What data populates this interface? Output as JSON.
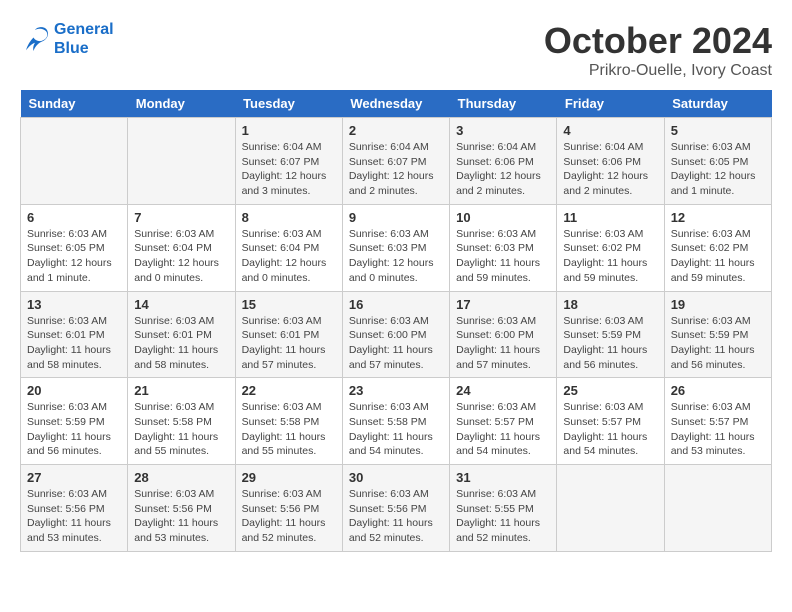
{
  "header": {
    "logo_line1": "General",
    "logo_line2": "Blue",
    "month": "October 2024",
    "location": "Prikro-Ouelle, Ivory Coast"
  },
  "weekdays": [
    "Sunday",
    "Monday",
    "Tuesday",
    "Wednesday",
    "Thursday",
    "Friday",
    "Saturday"
  ],
  "weeks": [
    [
      {
        "day": "",
        "info": ""
      },
      {
        "day": "",
        "info": ""
      },
      {
        "day": "1",
        "info": "Sunrise: 6:04 AM\nSunset: 6:07 PM\nDaylight: 12 hours and 3 minutes."
      },
      {
        "day": "2",
        "info": "Sunrise: 6:04 AM\nSunset: 6:07 PM\nDaylight: 12 hours and 2 minutes."
      },
      {
        "day": "3",
        "info": "Sunrise: 6:04 AM\nSunset: 6:06 PM\nDaylight: 12 hours and 2 minutes."
      },
      {
        "day": "4",
        "info": "Sunrise: 6:04 AM\nSunset: 6:06 PM\nDaylight: 12 hours and 2 minutes."
      },
      {
        "day": "5",
        "info": "Sunrise: 6:03 AM\nSunset: 6:05 PM\nDaylight: 12 hours and 1 minute."
      }
    ],
    [
      {
        "day": "6",
        "info": "Sunrise: 6:03 AM\nSunset: 6:05 PM\nDaylight: 12 hours and 1 minute."
      },
      {
        "day": "7",
        "info": "Sunrise: 6:03 AM\nSunset: 6:04 PM\nDaylight: 12 hours and 0 minutes."
      },
      {
        "day": "8",
        "info": "Sunrise: 6:03 AM\nSunset: 6:04 PM\nDaylight: 12 hours and 0 minutes."
      },
      {
        "day": "9",
        "info": "Sunrise: 6:03 AM\nSunset: 6:03 PM\nDaylight: 12 hours and 0 minutes."
      },
      {
        "day": "10",
        "info": "Sunrise: 6:03 AM\nSunset: 6:03 PM\nDaylight: 11 hours and 59 minutes."
      },
      {
        "day": "11",
        "info": "Sunrise: 6:03 AM\nSunset: 6:02 PM\nDaylight: 11 hours and 59 minutes."
      },
      {
        "day": "12",
        "info": "Sunrise: 6:03 AM\nSunset: 6:02 PM\nDaylight: 11 hours and 59 minutes."
      }
    ],
    [
      {
        "day": "13",
        "info": "Sunrise: 6:03 AM\nSunset: 6:01 PM\nDaylight: 11 hours and 58 minutes."
      },
      {
        "day": "14",
        "info": "Sunrise: 6:03 AM\nSunset: 6:01 PM\nDaylight: 11 hours and 58 minutes."
      },
      {
        "day": "15",
        "info": "Sunrise: 6:03 AM\nSunset: 6:01 PM\nDaylight: 11 hours and 57 minutes."
      },
      {
        "day": "16",
        "info": "Sunrise: 6:03 AM\nSunset: 6:00 PM\nDaylight: 11 hours and 57 minutes."
      },
      {
        "day": "17",
        "info": "Sunrise: 6:03 AM\nSunset: 6:00 PM\nDaylight: 11 hours and 57 minutes."
      },
      {
        "day": "18",
        "info": "Sunrise: 6:03 AM\nSunset: 5:59 PM\nDaylight: 11 hours and 56 minutes."
      },
      {
        "day": "19",
        "info": "Sunrise: 6:03 AM\nSunset: 5:59 PM\nDaylight: 11 hours and 56 minutes."
      }
    ],
    [
      {
        "day": "20",
        "info": "Sunrise: 6:03 AM\nSunset: 5:59 PM\nDaylight: 11 hours and 56 minutes."
      },
      {
        "day": "21",
        "info": "Sunrise: 6:03 AM\nSunset: 5:58 PM\nDaylight: 11 hours and 55 minutes."
      },
      {
        "day": "22",
        "info": "Sunrise: 6:03 AM\nSunset: 5:58 PM\nDaylight: 11 hours and 55 minutes."
      },
      {
        "day": "23",
        "info": "Sunrise: 6:03 AM\nSunset: 5:58 PM\nDaylight: 11 hours and 54 minutes."
      },
      {
        "day": "24",
        "info": "Sunrise: 6:03 AM\nSunset: 5:57 PM\nDaylight: 11 hours and 54 minutes."
      },
      {
        "day": "25",
        "info": "Sunrise: 6:03 AM\nSunset: 5:57 PM\nDaylight: 11 hours and 54 minutes."
      },
      {
        "day": "26",
        "info": "Sunrise: 6:03 AM\nSunset: 5:57 PM\nDaylight: 11 hours and 53 minutes."
      }
    ],
    [
      {
        "day": "27",
        "info": "Sunrise: 6:03 AM\nSunset: 5:56 PM\nDaylight: 11 hours and 53 minutes."
      },
      {
        "day": "28",
        "info": "Sunrise: 6:03 AM\nSunset: 5:56 PM\nDaylight: 11 hours and 53 minutes."
      },
      {
        "day": "29",
        "info": "Sunrise: 6:03 AM\nSunset: 5:56 PM\nDaylight: 11 hours and 52 minutes."
      },
      {
        "day": "30",
        "info": "Sunrise: 6:03 AM\nSunset: 5:56 PM\nDaylight: 11 hours and 52 minutes."
      },
      {
        "day": "31",
        "info": "Sunrise: 6:03 AM\nSunset: 5:55 PM\nDaylight: 11 hours and 52 minutes."
      },
      {
        "day": "",
        "info": ""
      },
      {
        "day": "",
        "info": ""
      }
    ]
  ]
}
